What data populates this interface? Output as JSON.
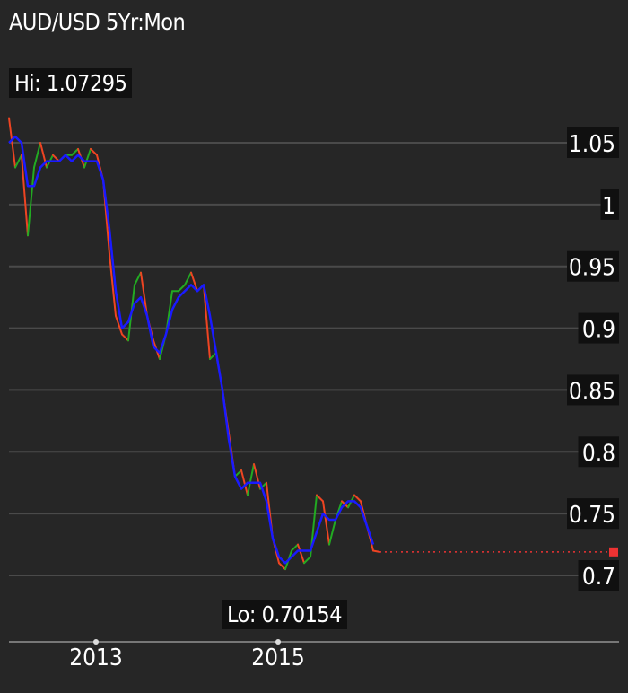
{
  "title": "AUD/USD 5Yr:Mon",
  "hi_label": "Hi: 1.07295",
  "lo_label": "Lo: 0.70154",
  "colors": {
    "background": "#262626",
    "grid": "#4a4a4a",
    "up": "#22aa22",
    "down": "#ee4422",
    "average": "#1a1aff",
    "last_marker": "#ee3333",
    "label_bg": "#101010",
    "text": "#ffffff"
  },
  "chart_data": {
    "type": "line",
    "title": "AUD/USD 5Yr:Mon",
    "xlabel": "",
    "ylabel": "",
    "ylim": [
      0.68,
      1.09
    ],
    "y_ticks": [
      1.05,
      1,
      0.95,
      0.9,
      0.85,
      0.8,
      0.75,
      0.7
    ],
    "y_tick_labels": [
      "1.05",
      "1",
      "0.95",
      "0.9",
      "0.85",
      "0.8",
      "0.75",
      "0.7"
    ],
    "x_ticks": [
      {
        "label": "2013",
        "index": 14
      },
      {
        "label": "2015",
        "index": 43
      }
    ],
    "grid": true,
    "high": 1.07295,
    "low": 0.70154,
    "last_value": 0.719,
    "series": [
      {
        "values": [
          1.07,
          1.03,
          1.04,
          0.975,
          1.03,
          1.05,
          1.03,
          1.04,
          1.035,
          1.04,
          1.04,
          1.045,
          1.03,
          1.045,
          1.04,
          1.02,
          0.96,
          0.91,
          0.895,
          0.89,
          0.935,
          0.945,
          0.91,
          0.89,
          0.875,
          0.895,
          0.93,
          0.93,
          0.935,
          0.945,
          0.93,
          0.935,
          0.875,
          0.88,
          0.85,
          0.815,
          0.78,
          0.785,
          0.765,
          0.79,
          0.77,
          0.775,
          0.73,
          0.71,
          0.705,
          0.72,
          0.725,
          0.71,
          0.715,
          0.765,
          0.76,
          0.725,
          0.745,
          0.76,
          0.755,
          0.765,
          0.76,
          0.74,
          0.72,
          0.719
        ]
      },
      {
        "values": [
          1.05,
          1.055,
          1.05,
          1.015,
          1.015,
          1.03,
          1.035,
          1.035,
          1.035,
          1.04,
          1.035,
          1.04,
          1.035,
          1.035,
          1.035,
          1.02,
          0.98,
          0.93,
          0.9,
          0.905,
          0.92,
          0.925,
          0.91,
          0.885,
          0.88,
          0.895,
          0.915,
          0.925,
          0.93,
          0.935,
          0.93,
          0.935,
          0.91,
          0.88,
          0.85,
          0.81,
          0.78,
          0.77,
          0.775,
          0.775,
          0.775,
          0.76,
          0.73,
          0.715,
          0.71,
          0.715,
          0.72,
          0.72,
          0.72,
          0.735,
          0.75,
          0.745,
          0.745,
          0.755,
          0.76,
          0.76,
          0.755,
          0.74,
          0.725
        ]
      }
    ]
  }
}
